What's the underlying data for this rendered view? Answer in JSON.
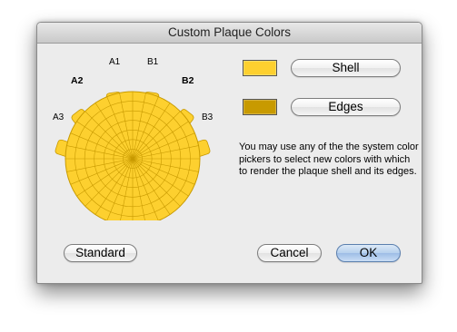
{
  "window": {
    "title": "Custom Plaque Colors"
  },
  "plaque": {
    "shell_color": "#fdd02f",
    "edge_color": "#c89a00",
    "ports": {
      "a1": "A1",
      "b1": "B1",
      "a2": "A2",
      "b2": "B2",
      "a3": "A3",
      "b3": "B3"
    }
  },
  "colors": {
    "shell_swatch": "#fdd02f",
    "edges_swatch": "#c89a00"
  },
  "buttons": {
    "shell": "Shell",
    "edges": "Edges",
    "standard": "Standard",
    "cancel": "Cancel",
    "ok": "OK"
  },
  "message": "You may use any of the the system color pickers to select new colors with which to render the plaque shell and its edges."
}
